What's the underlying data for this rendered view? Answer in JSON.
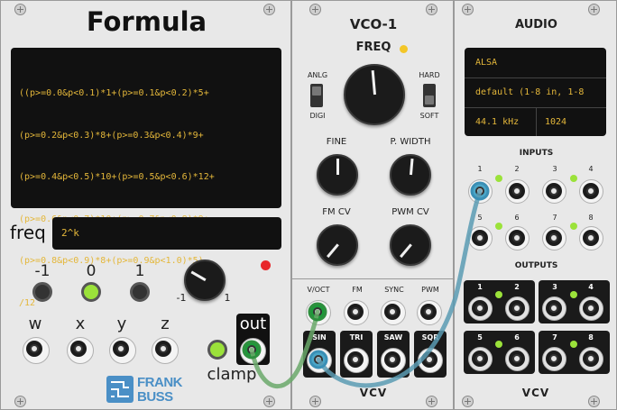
{
  "formula": {
    "title": "Formula",
    "expression_lines": [
      "((p>=0.0&p<0.1)*1+(p>=0.1&p<0.2)*5+",
      "(p>=0.2&p<0.3)*8+(p>=0.3&p<0.4)*9+",
      "(p>=0.4&p<0.5)*10+(p>=0.5&p<0.6)*12+",
      "(p>=0.6&p<0.7)*10+(p>=0.7&p<0.8)*9+",
      "(p>=0.8&p<0.9)*8+(p>=0.9&p<1.0)*5)",
      "/12"
    ],
    "freq_label": "freq",
    "freq_value": "2^k",
    "range_labels": [
      "-1",
      "0",
      "1"
    ],
    "knob_min": "-1",
    "knob_max": "1",
    "inputs": [
      "w",
      "x",
      "y",
      "z"
    ],
    "clamp_label": "clamp",
    "out_label": "out",
    "brand_line1": "FRANK",
    "brand_line2": "BUSS"
  },
  "vco": {
    "title": "VCO-1",
    "freq": "FREQ",
    "anlg": "ANLG",
    "digi": "DIGI",
    "hard": "HARD",
    "soft": "SOFT",
    "fine": "FINE",
    "pwidth": "P. WIDTH",
    "fmcv": "FM CV",
    "pwmcv": "PWM CV",
    "in_labels": [
      "V/OCT",
      "FM",
      "SYNC",
      "PWM"
    ],
    "out_labels": [
      "SIN",
      "TRI",
      "SAW",
      "SQR"
    ],
    "brand": "VCV"
  },
  "audio": {
    "title": "AUDIO",
    "driver": "ALSA",
    "device": "default (1-8 in, 1-8",
    "sample_rate": "44.1 kHz",
    "block_size": "1024",
    "inputs_label": "INPUTS",
    "outputs_label": "OUTPUTS",
    "in_nums": [
      "1",
      "2",
      "3",
      "4",
      "5",
      "6",
      "7",
      "8"
    ],
    "out_nums": [
      "1",
      "2",
      "3",
      "4",
      "5",
      "6",
      "7",
      "8"
    ],
    "brand": "VCV"
  },
  "colors": {
    "led_green": "#9be23a",
    "led_red": "#e8262a",
    "led_yellow": "#f3c628",
    "cable_green": "#6aa86a",
    "cable_blue": "#5a9bb3",
    "display_text": "#e4b73a"
  }
}
